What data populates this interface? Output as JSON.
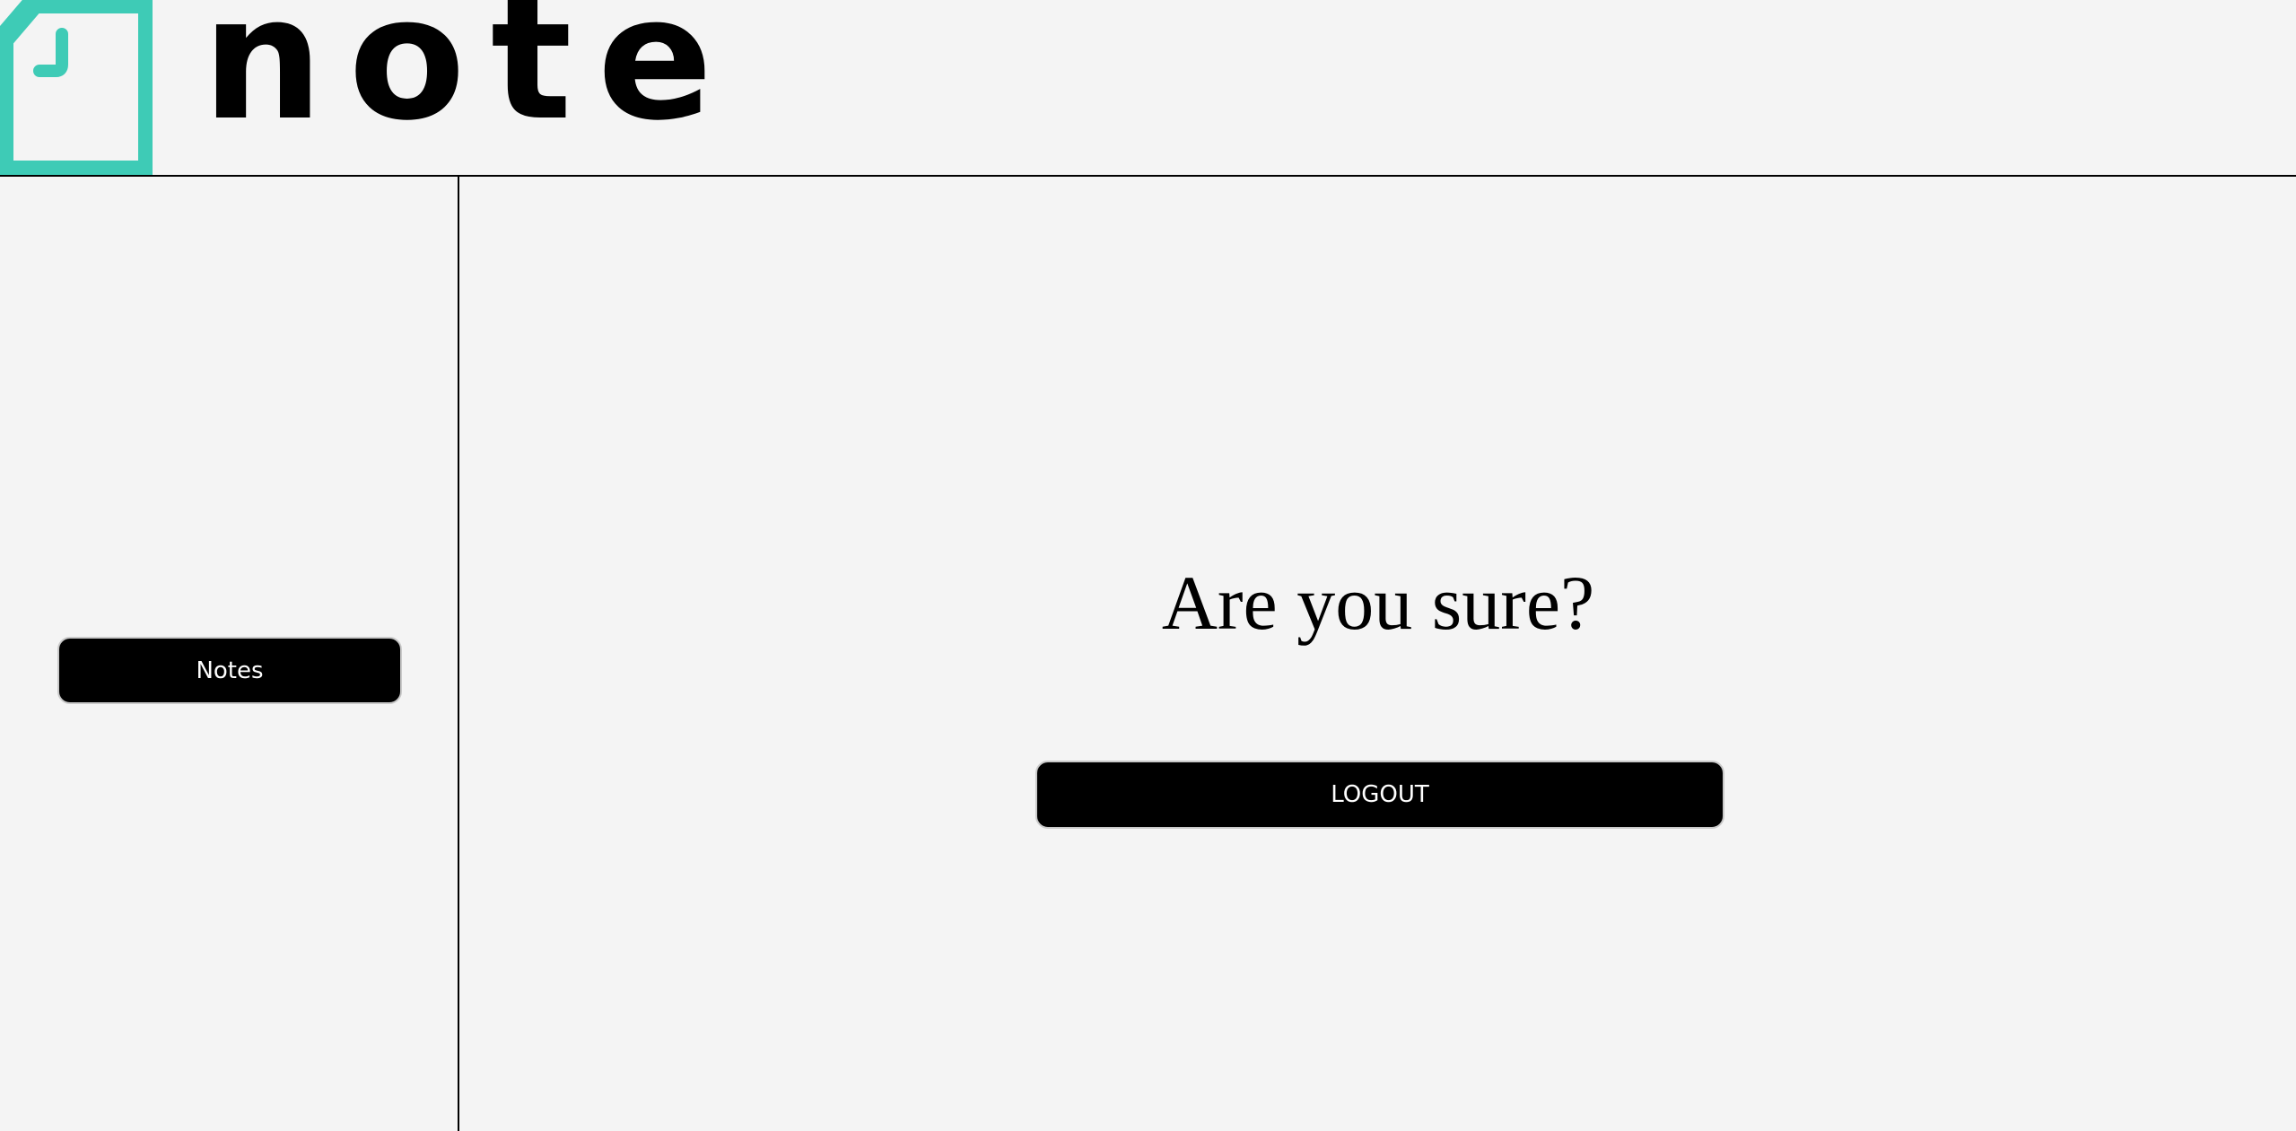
{
  "brand": {
    "name": "note",
    "icon": "note-document-icon",
    "accent_color": "#3ecbb6"
  },
  "sidebar": {
    "items": [
      {
        "label": "Notes"
      }
    ]
  },
  "main": {
    "title": "Are you sure?",
    "logout_label": "LOGOUT"
  }
}
